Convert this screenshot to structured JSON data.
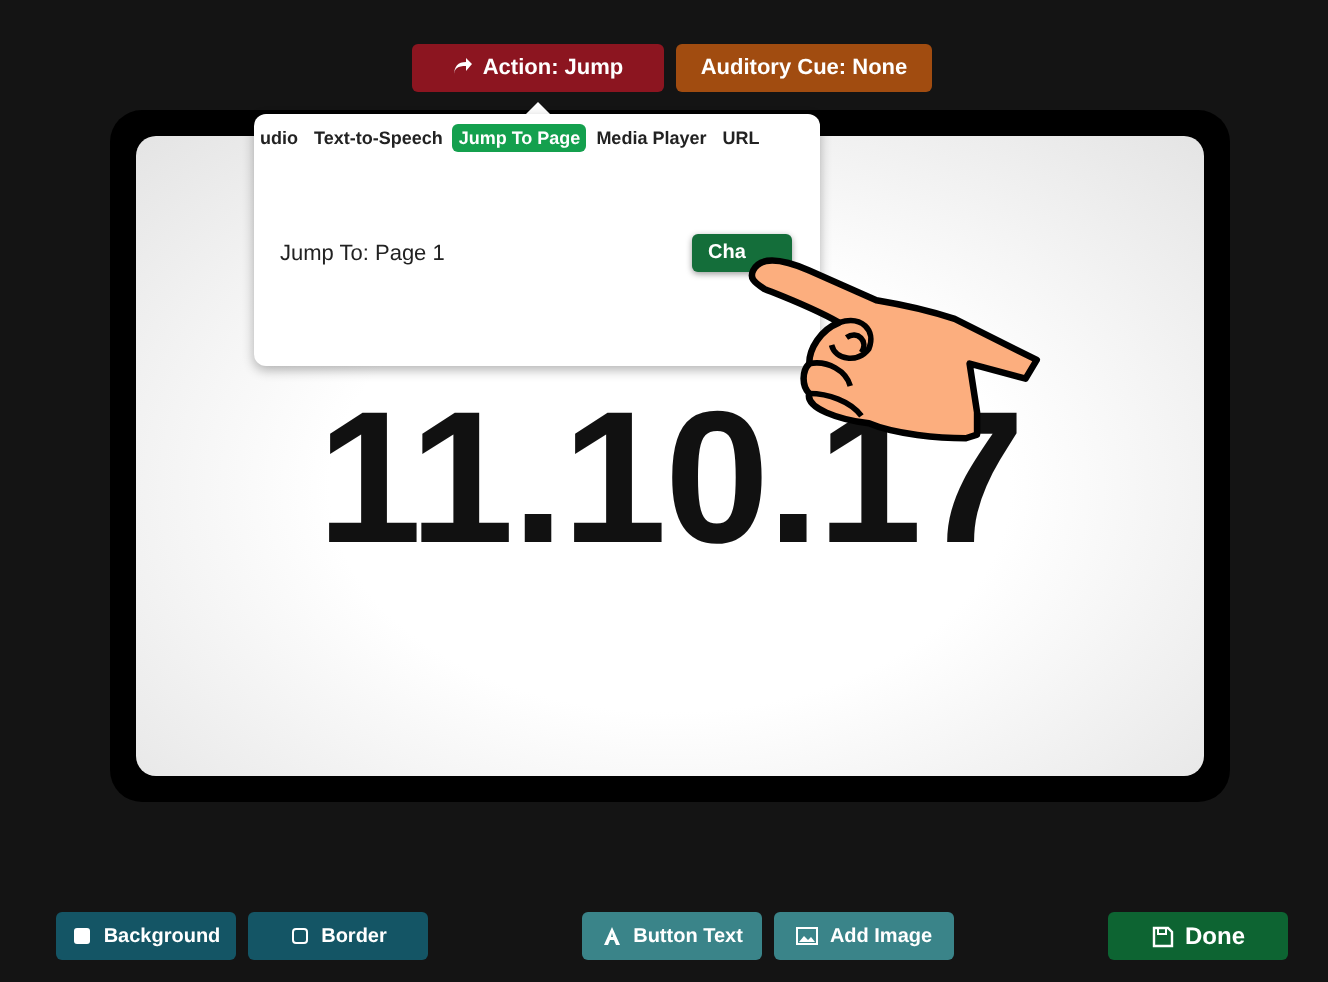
{
  "top_buttons": [
    {
      "kind": "action",
      "label": "Action: Jump"
    },
    {
      "kind": "cue",
      "label": "Auditory Cue: None"
    }
  ],
  "popover": {
    "tabs": [
      {
        "label": "udio",
        "selected": false
      },
      {
        "label": "Text-to-Speech",
        "selected": false
      },
      {
        "label": "Jump To Page",
        "selected": true
      },
      {
        "label": "Media Player",
        "selected": false
      },
      {
        "label": "URL",
        "selected": false
      }
    ],
    "jump_label": "Jump To: Page 1",
    "change_button": "Cha"
  },
  "card": {
    "text": "11.10.17"
  },
  "bottom_buttons": [
    {
      "kind": "background",
      "label": "Background"
    },
    {
      "kind": "border",
      "label": "Border"
    },
    {
      "kind": "text",
      "label": "Button Text"
    },
    {
      "kind": "image",
      "label": "Add Image"
    },
    {
      "kind": "done",
      "label": "Done"
    }
  ]
}
